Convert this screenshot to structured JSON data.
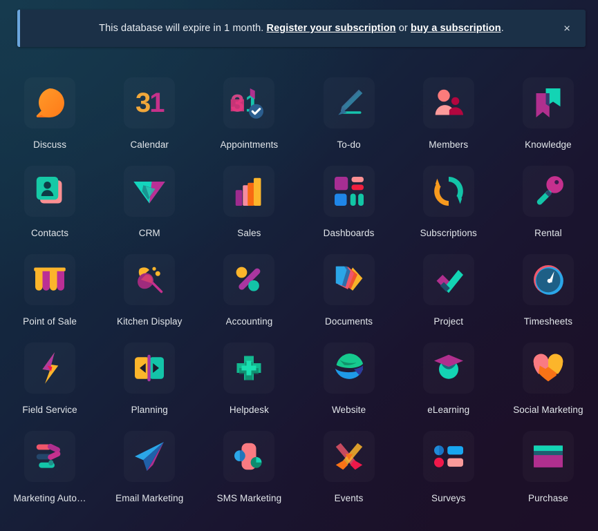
{
  "banner": {
    "message_prefix": "This database will expire in 1 month. ",
    "link_register": "Register your subscription",
    "message_middle": " or ",
    "link_buy": "buy a subscription",
    "message_suffix": ".",
    "close_label": "×",
    "accent_color": "#6ba6dd",
    "background_color": "#1b3047"
  },
  "apps": [
    {
      "label": "Discuss",
      "icon": "discuss-icon"
    },
    {
      "label": "Calendar",
      "icon": "calendar-icon"
    },
    {
      "label": "Appointments",
      "icon": "appointments-icon"
    },
    {
      "label": "To-do",
      "icon": "todo-icon"
    },
    {
      "label": "Members",
      "icon": "members-icon"
    },
    {
      "label": "Knowledge",
      "icon": "knowledge-icon"
    },
    {
      "label": "Contacts",
      "icon": "contacts-icon"
    },
    {
      "label": "CRM",
      "icon": "crm-icon"
    },
    {
      "label": "Sales",
      "icon": "sales-icon"
    },
    {
      "label": "Dashboards",
      "icon": "dashboards-icon"
    },
    {
      "label": "Subscriptions",
      "icon": "subscriptions-icon"
    },
    {
      "label": "Rental",
      "icon": "rental-icon"
    },
    {
      "label": "Point of Sale",
      "icon": "point-of-sale-icon"
    },
    {
      "label": "Kitchen Display",
      "icon": "kitchen-display-icon"
    },
    {
      "label": "Accounting",
      "icon": "accounting-icon"
    },
    {
      "label": "Documents",
      "icon": "documents-icon"
    },
    {
      "label": "Project",
      "icon": "project-icon"
    },
    {
      "label": "Timesheets",
      "icon": "timesheets-icon"
    },
    {
      "label": "Field Service",
      "icon": "field-service-icon"
    },
    {
      "label": "Planning",
      "icon": "planning-icon"
    },
    {
      "label": "Helpdesk",
      "icon": "helpdesk-icon"
    },
    {
      "label": "Website",
      "icon": "website-icon"
    },
    {
      "label": "eLearning",
      "icon": "elearning-icon"
    },
    {
      "label": "Social Marketing",
      "icon": "social-marketing-icon"
    },
    {
      "label": "Marketing Auto…",
      "icon": "marketing-automation-icon"
    },
    {
      "label": "Email Marketing",
      "icon": "email-marketing-icon"
    },
    {
      "label": "SMS Marketing",
      "icon": "sms-marketing-icon"
    },
    {
      "label": "Events",
      "icon": "events-icon"
    },
    {
      "label": "Surveys",
      "icon": "surveys-icon"
    },
    {
      "label": "Purchase",
      "icon": "purchase-icon"
    }
  ]
}
